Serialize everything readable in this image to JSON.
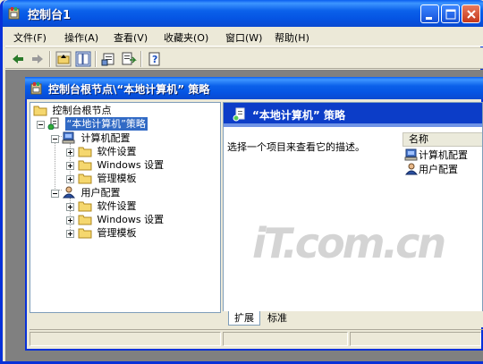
{
  "window": {
    "title": "控制台1"
  },
  "menu": [
    {
      "label": "文件(F)"
    },
    {
      "label": "操作(A)"
    },
    {
      "label": "查看(V)"
    },
    {
      "label": "收藏夹(O)"
    },
    {
      "label": "窗口(W)"
    },
    {
      "label": "帮助(H)"
    }
  ],
  "child": {
    "title": "控制台根节点\\“本地计算机” 策略"
  },
  "tree": {
    "root": "控制台根节点",
    "policy": "“本地计算机”策略",
    "computer": "计算机配置",
    "user": "用户配置",
    "software": "软件设置",
    "windows": "Windows 设置",
    "admin": "管理模板"
  },
  "right": {
    "header": "“本地计算机” 策略",
    "description": "选择一个项目来查看它的描述。",
    "column": "名称",
    "items": [
      "计算机配置",
      "用户配置"
    ]
  },
  "tabs": [
    "扩展",
    "标准"
  ],
  "watermark": "iT.com.cn",
  "colors": {
    "titlebar": "#0554e3",
    "selection": "#316ac5",
    "mdi": "#808080"
  }
}
